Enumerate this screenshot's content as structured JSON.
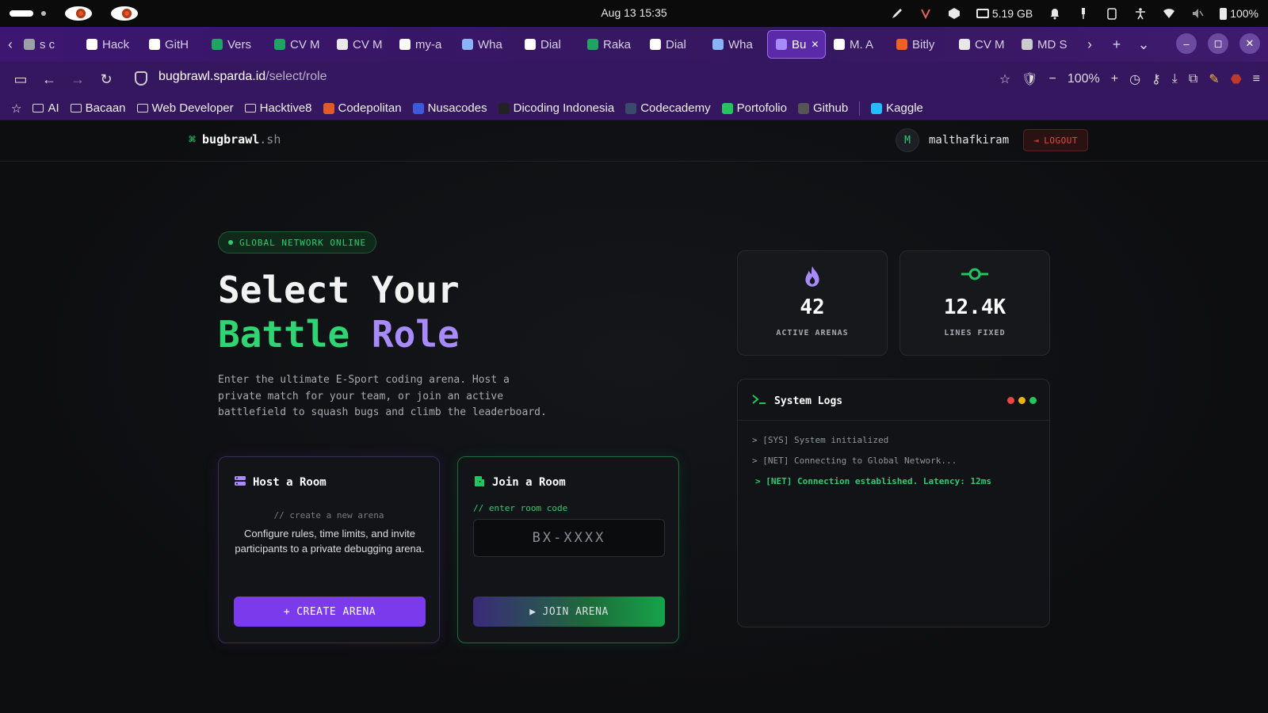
{
  "os": {
    "clock": "Aug 13  15:35",
    "memory": "5.19 GB",
    "battery": "100%"
  },
  "browser": {
    "tabs": [
      {
        "label": "s c",
        "fav": "#9aa0a6"
      },
      {
        "label": "Hack",
        "fav": "#ffffff"
      },
      {
        "label": "GitH",
        "fav": "#ffffff"
      },
      {
        "label": "Vers",
        "fav": "#1fa463"
      },
      {
        "label": "CV M",
        "fav": "#1fa463"
      },
      {
        "label": "CV M",
        "fav": "#e8e8e8"
      },
      {
        "label": "my-a",
        "fav": "#ffffff"
      },
      {
        "label": "Wha",
        "fav": "#8ab4f8"
      },
      {
        "label": "Dial",
        "fav": "#ffffff"
      },
      {
        "label": "Raka",
        "fav": "#1fa463"
      },
      {
        "label": "Dial",
        "fav": "#ffffff"
      },
      {
        "label": "Wha",
        "fav": "#8ab4f8"
      },
      {
        "label": "Bu",
        "fav": "#a78bfa",
        "active": true
      },
      {
        "label": "M. A",
        "fav": "#ffffff"
      },
      {
        "label": "Bitly",
        "fav": "#ee6123"
      },
      {
        "label": "CV M",
        "fav": "#e8e8e8"
      },
      {
        "label": "MD S",
        "fav": "#cccccc"
      }
    ],
    "url_domain": "bugbrawl.sparda.id",
    "url_path": "/select/role",
    "zoom": "100%",
    "bookmarks": [
      {
        "label": "AI",
        "type": "folder"
      },
      {
        "label": "Bacaan",
        "type": "folder"
      },
      {
        "label": "Web Developer",
        "type": "folder"
      },
      {
        "label": "Hacktive8",
        "type": "folder"
      },
      {
        "label": "Codepolitan",
        "type": "fav",
        "color": "#e05a2a"
      },
      {
        "label": "Nusacodes",
        "type": "fav",
        "color": "#3b5bdb"
      },
      {
        "label": "Dicoding Indonesia",
        "type": "fav",
        "color": "#222222"
      },
      {
        "label": "Codecademy",
        "type": "fav",
        "color": "#3a4a6a"
      },
      {
        "label": "Portofolio",
        "type": "fav",
        "color": "#22c55e"
      },
      {
        "label": "Github",
        "type": "fav",
        "color": "#555555"
      },
      {
        "label": "Kaggle",
        "type": "fav",
        "color": "#20beff"
      }
    ]
  },
  "app": {
    "brand_symbol": "⌘",
    "brand_name": "bugbrawl",
    "brand_ext": ".sh",
    "avatar_letter": "M",
    "username": "malthafkiram",
    "logout_label": "LOGOUT",
    "status_label": "GLOBAL NETWORK ONLINE",
    "hero_line1": "Select Your",
    "hero_word_a": "Battle",
    "hero_word_b": "Role",
    "hero_desc": "Enter the ultimate E-Sport coding arena. Host a private match for your team, or join an active battlefield to squash bugs and climb the leaderboard.",
    "host": {
      "title": "Host a Room",
      "sub": "// create a new arena",
      "desc": "Configure rules, time limits, and invite participants to a private debugging arena.",
      "button": "CREATE ARENA"
    },
    "join": {
      "title": "Join a Room",
      "sub": "// enter room code",
      "placeholder": "BX-XXXX",
      "button": "JOIN ARENA"
    },
    "stats": [
      {
        "value": "42",
        "label": "ACTIVE ARENAS"
      },
      {
        "value": "12.4K",
        "label": "LINES FIXED"
      }
    ],
    "logs": {
      "title": "System Logs",
      "lines": [
        "> [SYS] System initialized",
        "> [NET] Connecting to Global Network...",
        "> [NET] Connection established. Latency: 12ms"
      ]
    }
  }
}
